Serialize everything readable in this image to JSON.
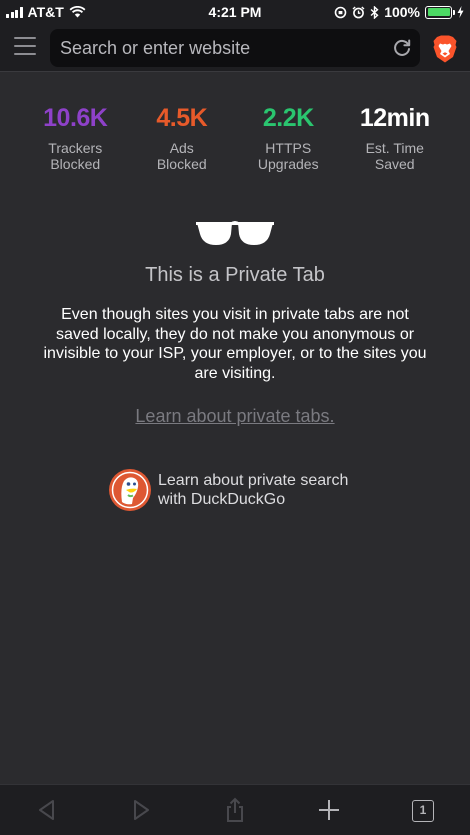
{
  "status_bar": {
    "carrier": "AT&T",
    "time": "4:21 PM",
    "battery": "100%",
    "battery_level": 1.0
  },
  "nav": {
    "search_placeholder": "Search or enter website"
  },
  "stats": [
    {
      "value": "10.6K",
      "label_line1": "Trackers",
      "label_line2": "Blocked",
      "color": "#8e41c9"
    },
    {
      "value": "4.5K",
      "label_line1": "Ads",
      "label_line2": "Blocked",
      "color": "#e75a2a"
    },
    {
      "value": "2.2K",
      "label_line1": "HTTPS",
      "label_line2": "Upgrades",
      "color": "#2ac56f"
    },
    {
      "value": "12min",
      "label_line1": "Est. Time",
      "label_line2": "Saved",
      "color": "#ffffff"
    }
  ],
  "private": {
    "title": "This is a Private Tab",
    "description": "Even though sites you visit in private tabs are not saved locally, they do not make you anonymous or invisible to your ISP, your employer, or to the sites you are visiting.",
    "learn_link": "Learn about private tabs.",
    "ddg_line1": "Learn about private search",
    "ddg_line2": "with DuckDuckGo"
  },
  "toolbar": {
    "tab_count": "1"
  },
  "colors": {
    "background": "#2b2b2e",
    "bar": "#1e1e21",
    "brave_orange": "#fb542b"
  },
  "icons": [
    "menu-icon",
    "reload-icon",
    "brave-lion-icon",
    "glasses-icon",
    "duckduckgo-icon",
    "back-icon",
    "forward-icon",
    "share-icon",
    "plus-icon",
    "tabs-icon"
  ]
}
